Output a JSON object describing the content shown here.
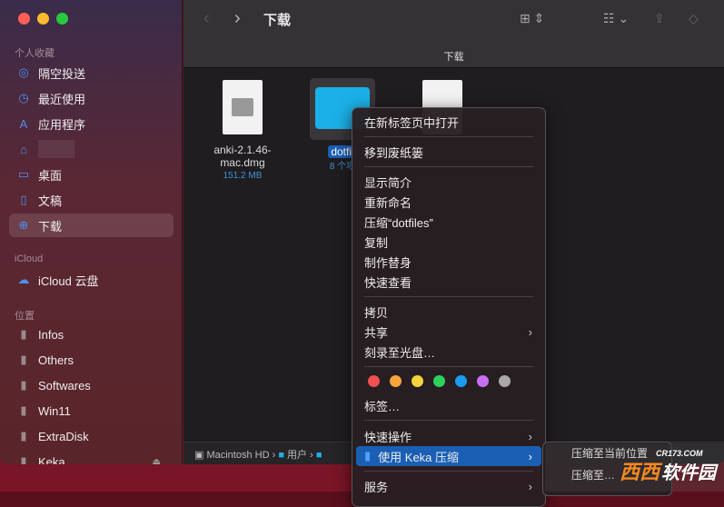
{
  "window": {
    "title": "下载",
    "path_bar_title": "下载"
  },
  "sidebar": {
    "sections": [
      {
        "label": "个人收藏"
      },
      {
        "label": "iCloud"
      },
      {
        "label": "位置"
      }
    ],
    "favorites": [
      {
        "label": "隔空投送",
        "icon": "airdrop-icon"
      },
      {
        "label": "最近使用",
        "icon": "clock-icon"
      },
      {
        "label": "应用程序",
        "icon": "apps-icon"
      },
      {
        "label": "",
        "icon": "home-icon"
      },
      {
        "label": "桌面",
        "icon": "desktop-icon"
      },
      {
        "label": "文稿",
        "icon": "document-icon"
      },
      {
        "label": "下载",
        "icon": "download-icon",
        "selected": true
      }
    ],
    "icloud": [
      {
        "label": "iCloud 云盘",
        "icon": "cloud-icon"
      }
    ],
    "locations": [
      {
        "label": "Infos"
      },
      {
        "label": "Others"
      },
      {
        "label": "Softwares"
      },
      {
        "label": "Win11"
      },
      {
        "label": "ExtraDisk"
      },
      {
        "label": "Keka"
      }
    ]
  },
  "files": [
    {
      "name1": "anki-2.1.46-",
      "name2": "mac.dmg",
      "info": "151.2 MB"
    },
    {
      "name1": "dotfil",
      "info": "8 个项"
    }
  ],
  "pathbar": [
    "Macintosh HD",
    "用户"
  ],
  "context_menu": {
    "items": [
      "在新标签页中打开",
      "移到废纸篓",
      "显示简介",
      "重新命名",
      "压缩“dotfiles”",
      "复制",
      "制作替身",
      "快速查看",
      "拷贝",
      "共享",
      "刻录至光盘…",
      "标签…",
      "快速操作",
      "使用 Keka 压缩",
      "服务"
    ],
    "tag_colors": [
      "#f0504f",
      "#f7a53b",
      "#f5d33e",
      "#2dd15a",
      "#1a9cf0",
      "#c66ff0",
      "#a8a8a8"
    ]
  },
  "submenu": {
    "items": [
      "压缩至当前位置",
      "压缩至…"
    ]
  },
  "watermark": {
    "text1": "西西",
    "text2": "软件园",
    "text3": "CR173.COM"
  }
}
